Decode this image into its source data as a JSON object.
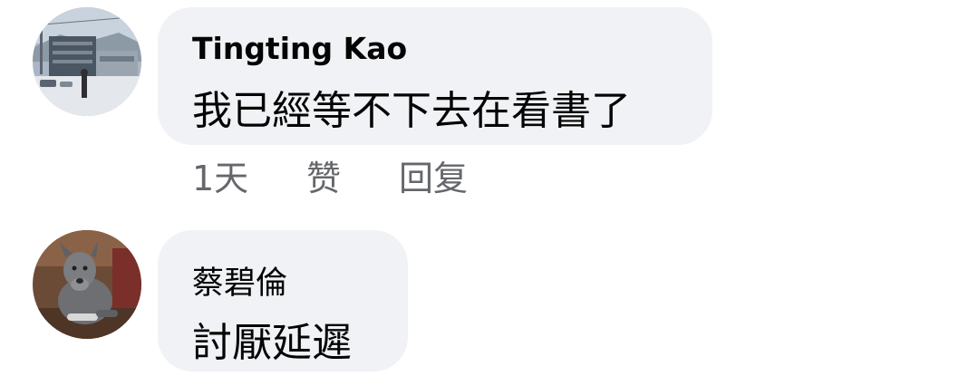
{
  "comments": [
    {
      "author": "Tingting Kao",
      "text": "我已經等不下去在看書了",
      "avatar_icon": "avatar-photo-street",
      "time": "1天",
      "like_label": "赞",
      "reply_label": "回复"
    },
    {
      "author": "蔡碧倫",
      "text": "討厭延遲",
      "avatar_icon": "avatar-photo-dog"
    }
  ],
  "colors": {
    "bubble_bg": "#f0f2f5",
    "text": "#050505",
    "secondary_text": "#65676b"
  }
}
